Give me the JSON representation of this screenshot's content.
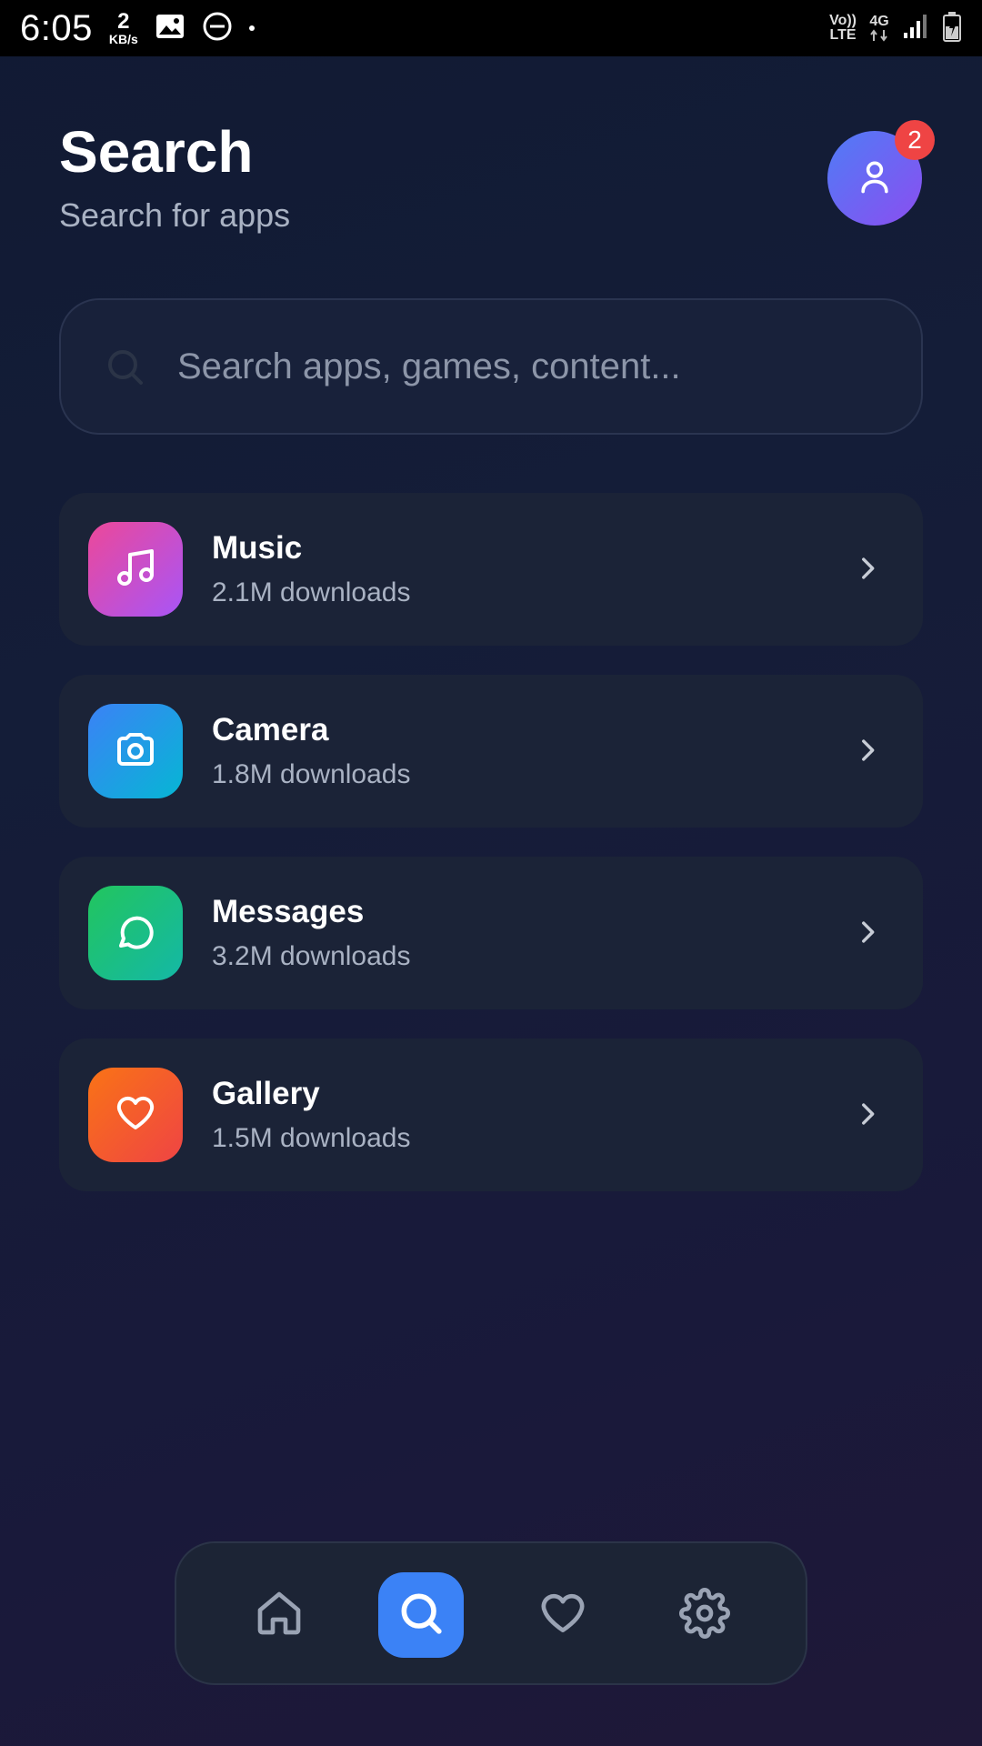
{
  "status_bar": {
    "time": "6:05",
    "net_speed_value": "2",
    "net_speed_unit": "KB/s",
    "volte_top": "Vo))",
    "volte_bottom": "LTE",
    "network_type": "4G"
  },
  "header": {
    "title": "Search",
    "subtitle": "Search for apps",
    "notification_count": "2"
  },
  "search": {
    "placeholder": "Search apps, games, content..."
  },
  "apps": [
    {
      "name": "Music",
      "downloads": "2.1M downloads",
      "icon": "music-note-icon",
      "gradient": [
        "#ec4899",
        "#a855f7"
      ]
    },
    {
      "name": "Camera",
      "downloads": "1.8M downloads",
      "icon": "camera-icon",
      "gradient": [
        "#3b82f6",
        "#06b6d4"
      ]
    },
    {
      "name": "Messages",
      "downloads": "3.2M downloads",
      "icon": "message-bubble-icon",
      "gradient": [
        "#22c55e",
        "#14b8a6"
      ]
    },
    {
      "name": "Gallery",
      "downloads": "1.5M downloads",
      "icon": "heart-icon",
      "gradient": [
        "#f97316",
        "#ef4444"
      ]
    }
  ],
  "bottom_nav": {
    "items": [
      {
        "icon": "home-icon",
        "active": false
      },
      {
        "icon": "search-icon",
        "active": true
      },
      {
        "icon": "heart-icon",
        "active": false
      },
      {
        "icon": "settings-gear-icon",
        "active": false
      }
    ]
  },
  "colors": {
    "accent": "#3b82f6",
    "badge": "#ef4444",
    "card_bg": "#1b2337",
    "text_secondary": "#a9b2c3"
  }
}
